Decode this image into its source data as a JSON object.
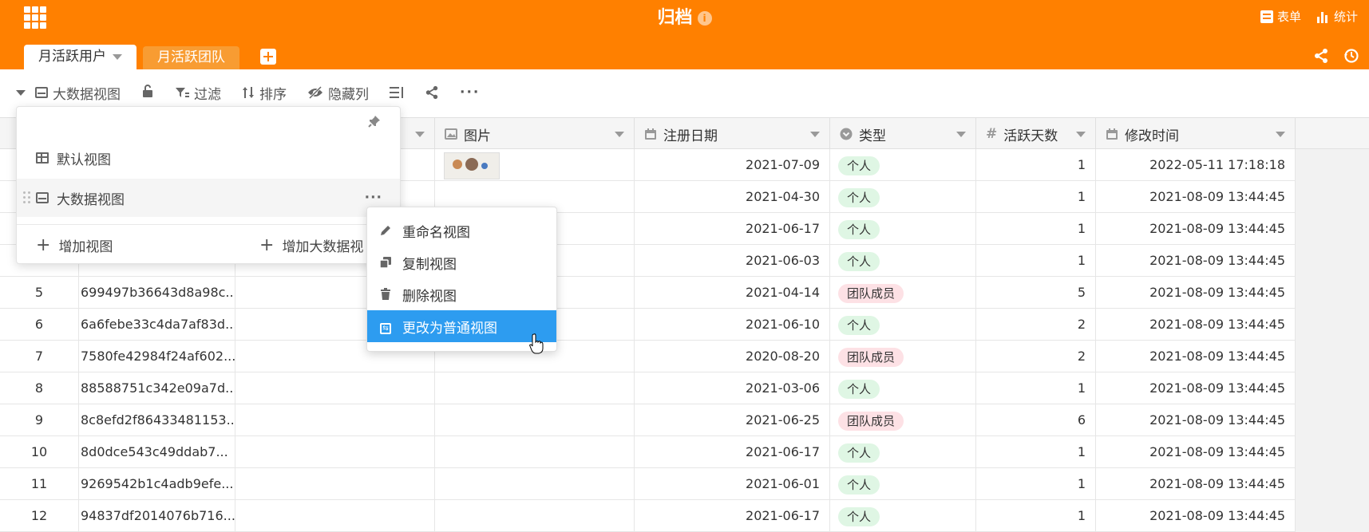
{
  "header": {
    "title": "归档",
    "info_icon": "info-icon",
    "form_label": "表单",
    "stats_label": "统计"
  },
  "tabs": [
    {
      "label": "月活跃用户",
      "active": true
    },
    {
      "label": "月活跃团队",
      "active": false
    }
  ],
  "toolbar": {
    "view_name": "大数据视图",
    "filter": "过滤",
    "sort": "排序",
    "hide_columns": "隐藏列"
  },
  "columns": {
    "picture": "图片",
    "reg_date": "注册日期",
    "type": "类型",
    "active_days": "活跃天数",
    "modified": "修改时间"
  },
  "views_popup": {
    "default_view": "默认视图",
    "bigdata_view": "大数据视图",
    "add_view": "增加视图",
    "add_bigdata_view": "增加大数据视"
  },
  "context_menu": {
    "rename": "重命名视图",
    "duplicate": "复制视图",
    "delete": "删除视图",
    "convert": "更改为普通视图"
  },
  "rows": [
    {
      "num": "",
      "id": "",
      "date": "2021-07-09",
      "type": "个人",
      "days": "1",
      "modified": "2022-05-11 17:18:18",
      "has_image": true
    },
    {
      "num": "",
      "id": "",
      "date": "2021-04-30",
      "type": "个人",
      "days": "1",
      "modified": "2021-08-09 13:44:45"
    },
    {
      "num": "",
      "id": "",
      "date": "2021-06-17",
      "type": "个人",
      "days": "1",
      "modified": "2021-08-09 13:44:45"
    },
    {
      "num": "",
      "id": "",
      "date": "2021-06-03",
      "type": "个人",
      "days": "1",
      "modified": "2021-08-09 13:44:45"
    },
    {
      "num": "5",
      "id": "699497b36643d8a98c...",
      "date": "2021-04-14",
      "type": "团队成员",
      "days": "5",
      "modified": "2021-08-09 13:44:45"
    },
    {
      "num": "6",
      "id": "6a6febe33c4da7af83d...",
      "date": "2021-06-10",
      "type": "个人",
      "days": "2",
      "modified": "2021-08-09 13:44:45"
    },
    {
      "num": "7",
      "id": "7580fe42984f24af602...",
      "date": "2020-08-20",
      "type": "团队成员",
      "days": "2",
      "modified": "2021-08-09 13:44:45"
    },
    {
      "num": "8",
      "id": "88588751c342e09a7d...",
      "date": "2021-03-06",
      "type": "个人",
      "days": "1",
      "modified": "2021-08-09 13:44:45"
    },
    {
      "num": "9",
      "id": "8c8efd2f86433481153...",
      "date": "2021-06-25",
      "type": "团队成员",
      "days": "6",
      "modified": "2021-08-09 13:44:45"
    },
    {
      "num": "10",
      "id": "8d0dce543c49ddab7...",
      "date": "2021-06-17",
      "type": "个人",
      "days": "1",
      "modified": "2021-08-09 13:44:45"
    },
    {
      "num": "11",
      "id": "9269542b1c4adb9efe...",
      "date": "2021-06-01",
      "type": "个人",
      "days": "1",
      "modified": "2021-08-09 13:44:45"
    },
    {
      "num": "12",
      "id": "94837df2014076b716...",
      "date": "2021-06-17",
      "type": "个人",
      "days": "1",
      "modified": "2021-08-09 13:44:45"
    }
  ],
  "colors": {
    "brand": "#ff8000",
    "highlight": "#2d9cf0",
    "tag_personal": "#dff6e4",
    "tag_team": "#fde1e5"
  }
}
